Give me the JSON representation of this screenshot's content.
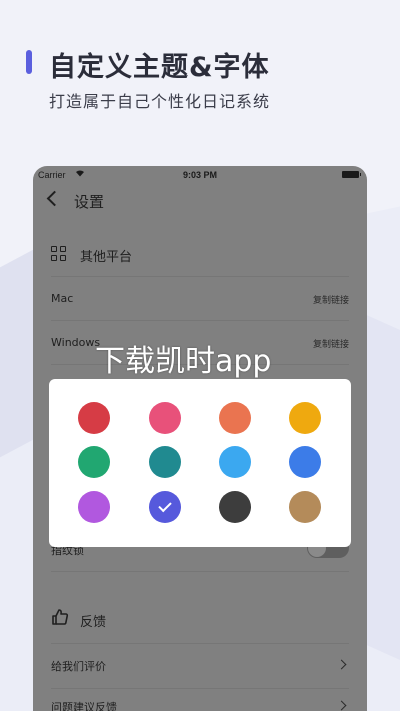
{
  "promo": {
    "title": "自定义主题&字体",
    "subtitle": "打造属于自己个性化日记系统",
    "accent": "#5b5fde"
  },
  "status_bar": {
    "carrier": "Carrier",
    "time": "9:03 PM"
  },
  "nav": {
    "title": "设置",
    "back_icon": "chevron-left-icon"
  },
  "settings": {
    "other_platforms": {
      "title": "其他平台",
      "icon": "grid-icon",
      "items": [
        {
          "label": "Mac",
          "action": "复制链接"
        },
        {
          "label": "Windows",
          "action": "复制链接"
        }
      ]
    },
    "partial_toggle_label": "指纹锁",
    "feedback": {
      "title": "反馈",
      "icon": "thumbs-up-icon",
      "items": [
        {
          "label": "给我们评价"
        },
        {
          "label": "问题建议反馈"
        }
      ]
    }
  },
  "watermark": "下载凯时app",
  "color_picker": {
    "selected_index": 9,
    "colors": [
      "#d63c45",
      "#e8517a",
      "#ea7450",
      "#efa90f",
      "#21a771",
      "#208a90",
      "#3ba8f0",
      "#3c7ce8",
      "#b158df",
      "#5659dc",
      "#3d3d3d",
      "#b48b5a"
    ]
  }
}
